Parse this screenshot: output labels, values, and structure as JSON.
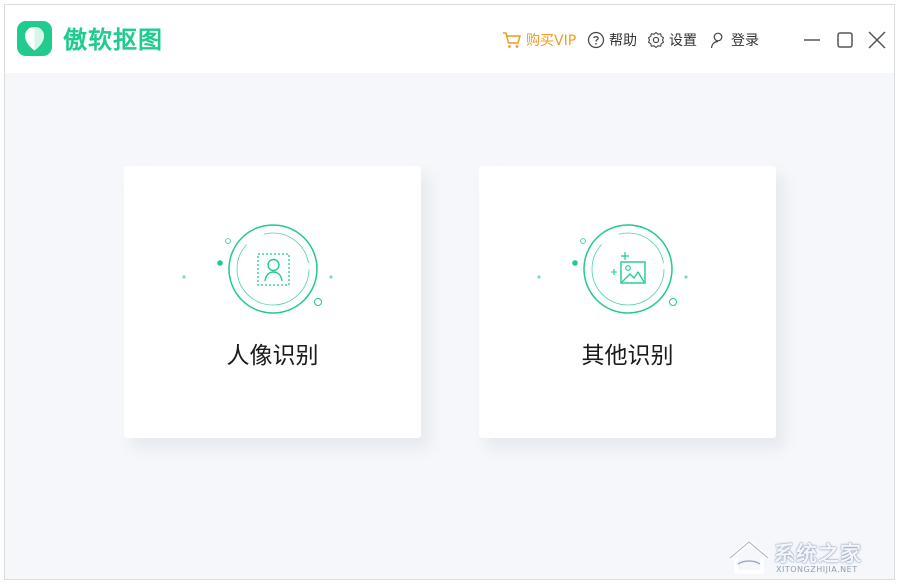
{
  "app": {
    "title": "傲软抠图"
  },
  "menu": {
    "vip": "购买VIP",
    "help": "帮助",
    "settings": "设置",
    "login": "登录"
  },
  "cards": [
    {
      "label": "人像识别",
      "icon": "portrait-recognition-icon"
    },
    {
      "label": "其他识别",
      "icon": "image-recognition-icon"
    }
  ],
  "watermark": {
    "text": "系统之家",
    "url": "XITONGZHIJIA.NET"
  },
  "colors": {
    "accent": "#1fcb8d",
    "vip": "#f29a1f",
    "background": "#f5f7fa",
    "card": "#ffffff"
  }
}
